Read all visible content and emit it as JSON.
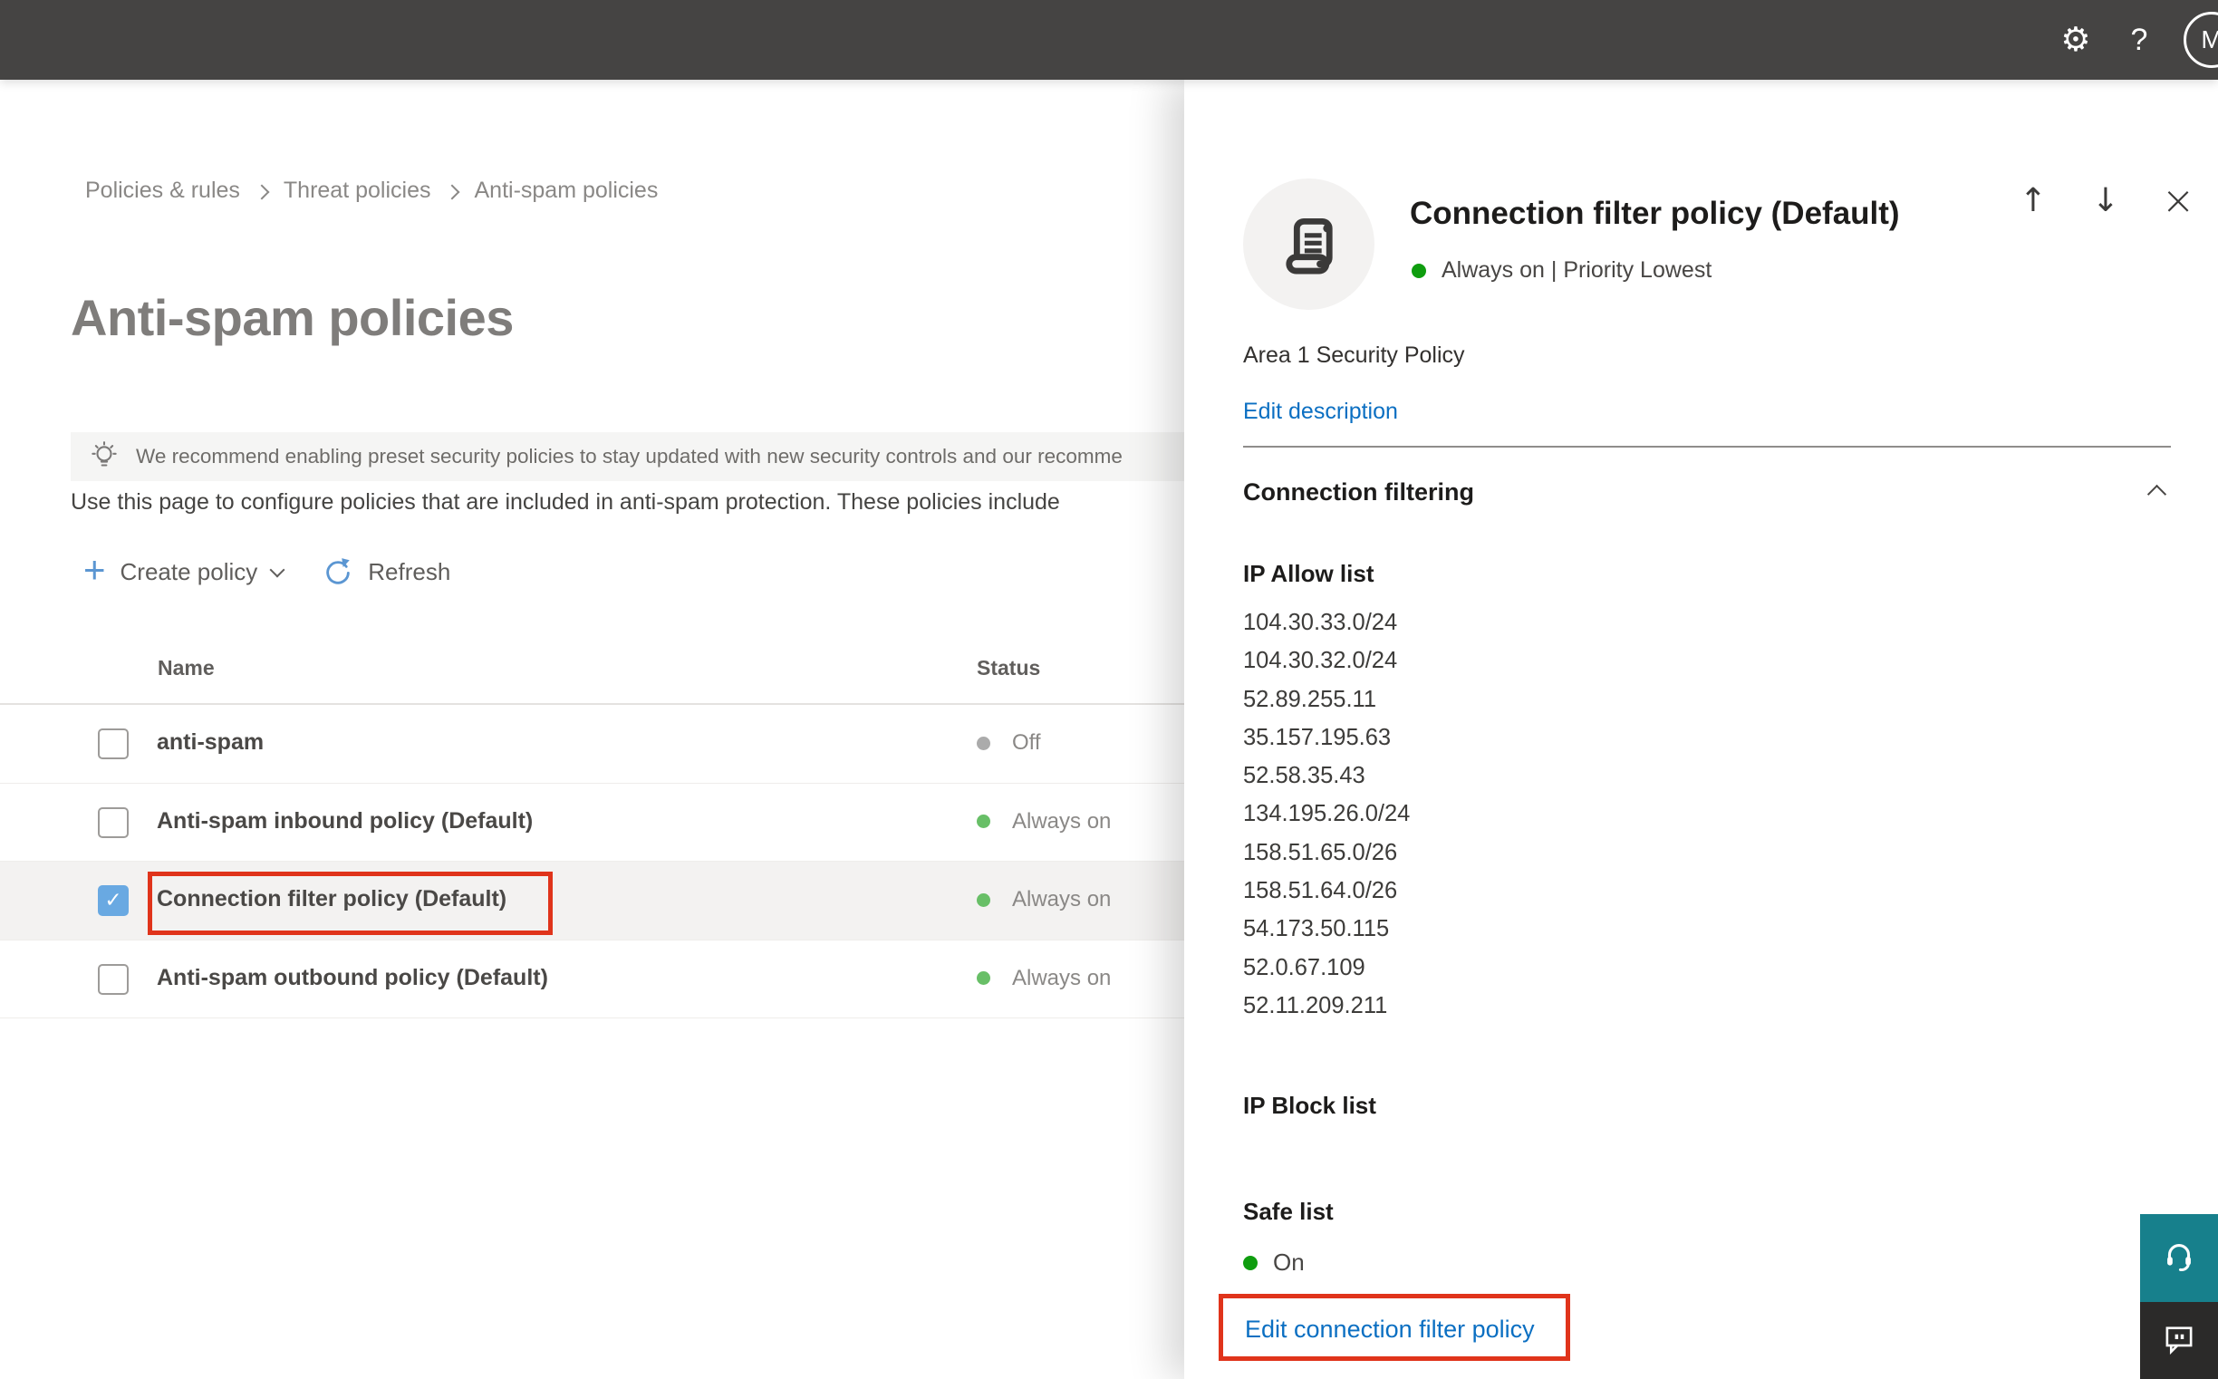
{
  "topbar": {
    "settings_icon": "⚙",
    "help_icon": "?",
    "avatar_initial": "M"
  },
  "breadcrumb": {
    "items": [
      "Policies & rules",
      "Threat policies",
      "Anti-spam policies"
    ]
  },
  "page": {
    "title": "Anti-spam policies",
    "banner_text": "We recommend enabling preset security policies to stay updated with new security controls and our recomme",
    "description": "Use this page to configure policies that are included in anti-spam protection. These policies include",
    "toolbar": {
      "create_policy": "Create policy",
      "refresh": "Refresh"
    }
  },
  "table": {
    "columns": [
      "Name",
      "Status"
    ],
    "rows": [
      {
        "name": "anti-spam",
        "status": "Off",
        "dot_color": "#ababab",
        "row_bg": "#ffffff",
        "checkbox_bg": "#ffffff",
        "check_glyph": ""
      },
      {
        "name": "Anti-spam inbound policy (Default)",
        "status": "Always on",
        "dot_color": "#68bf67",
        "row_bg": "#ffffff",
        "checkbox_bg": "#ffffff",
        "check_glyph": ""
      },
      {
        "name": "Connection filter policy (Default)",
        "status": "Always on",
        "dot_color": "#68bf67",
        "row_bg": "#f3f2f1",
        "checkbox_bg": "#69a9e2",
        "check_glyph": "✓"
      },
      {
        "name": "Anti-spam outbound policy (Default)",
        "status": "Always on",
        "dot_color": "#68bf67",
        "row_bg": "#ffffff",
        "checkbox_bg": "#ffffff",
        "check_glyph": ""
      }
    ]
  },
  "panel": {
    "title": "Connection filter policy (Default)",
    "status_line": "Always on | Priority Lowest",
    "policy_description": "Area 1 Security Policy",
    "edit_description_link": "Edit description",
    "section_title": "Connection filtering",
    "ip_allow_label": "IP Allow list",
    "ip_allow_list": [
      "104.30.33.0/24",
      "104.30.32.0/24",
      "52.89.255.11",
      "35.157.195.63",
      "52.58.35.43",
      "134.195.26.0/24",
      "158.51.65.0/26",
      "158.51.64.0/26",
      "54.173.50.115",
      "52.0.67.109",
      "52.11.209.211"
    ],
    "ip_block_label": "IP Block list",
    "safe_list_label": "Safe list",
    "safe_list_status": "On",
    "edit_link": "Edit connection filter policy",
    "nav": {
      "up_icon": "↑",
      "down_icon": "↓",
      "close_icon": "×"
    }
  },
  "colors": {
    "annotation_red": "#e0341b",
    "panel_green_dot": "#0f9d0f",
    "link_blue": "#0b6fc2",
    "teal_button": "#17808c",
    "dark_button": "#2b2a29"
  }
}
